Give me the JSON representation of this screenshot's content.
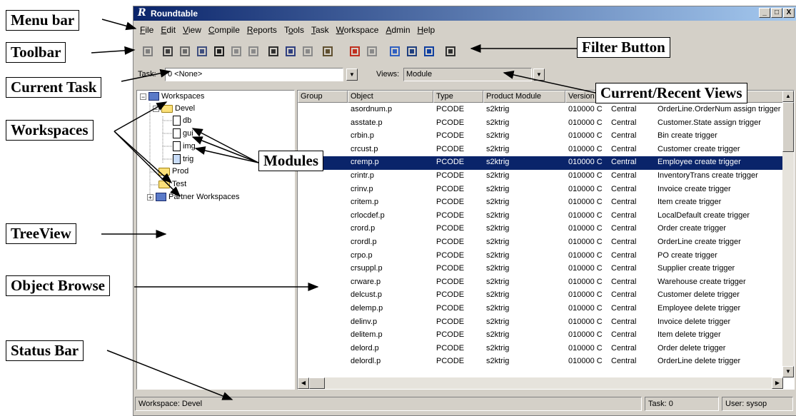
{
  "window": {
    "app_icon": "R",
    "title": "Roundtable",
    "controls": [
      "_",
      "□",
      "X"
    ]
  },
  "menu": [
    {
      "pre": "",
      "ul": "F",
      "post": "ile"
    },
    {
      "pre": "",
      "ul": "E",
      "post": "dit"
    },
    {
      "pre": "",
      "ul": "V",
      "post": "iew"
    },
    {
      "pre": "",
      "ul": "C",
      "post": "ompile"
    },
    {
      "pre": "",
      "ul": "R",
      "post": "eports"
    },
    {
      "pre": "T",
      "ul": "o",
      "post": "ols"
    },
    {
      "pre": "",
      "ul": "T",
      "post": "ask"
    },
    {
      "pre": "",
      "ul": "W",
      "post": "orkspace"
    },
    {
      "pre": "",
      "ul": "A",
      "post": "dmin"
    },
    {
      "pre": "",
      "ul": "H",
      "post": "elp"
    }
  ],
  "toolbar_icons": [
    "checkout-icon",
    "checkin-icon",
    "edit-icon",
    "search-icon",
    "find-icon",
    "new-icon",
    "open-icon",
    "properties-icon",
    "compare-icon",
    "assign-icon",
    "report-icon",
    "palette-icon",
    "clipboard-icon",
    "move-left-icon",
    "move-right-icon",
    "copy-icon",
    "filter-icon"
  ],
  "task_bar": {
    "task_label": "Task:",
    "task_value": "0 <None>",
    "views_label": "Views:",
    "views_value": "Module"
  },
  "tree": {
    "root": "Workspaces",
    "devel": "Devel",
    "modules": [
      "db",
      "gui",
      "img",
      "trig"
    ],
    "prod": "Prod",
    "test": "Test",
    "partner": "Partner Workspaces"
  },
  "browse": {
    "columns": [
      "Group",
      "Object",
      "Type",
      "Product Module",
      "Version",
      "",
      ""
    ],
    "rows": [
      [
        "",
        "asordnum.p",
        "PCODE",
        "s2ktrig",
        "010000 C",
        "Central",
        "OrderLine.OrderNum assign trigger"
      ],
      [
        "",
        "asstate.p",
        "PCODE",
        "s2ktrig",
        "010000 C",
        "Central",
        "Customer.State assign trigger"
      ],
      [
        "",
        "crbin.p",
        "PCODE",
        "s2ktrig",
        "010000 C",
        "Central",
        "Bin create trigger"
      ],
      [
        "",
        "crcust.p",
        "PCODE",
        "s2ktrig",
        "010000 C",
        "Central",
        "Customer create trigger"
      ],
      [
        "",
        "cremp.p",
        "PCODE",
        "s2ktrig",
        "010000 C",
        "Central",
        "Employee create trigger"
      ],
      [
        "",
        "crintr.p",
        "PCODE",
        "s2ktrig",
        "010000 C",
        "Central",
        "InventoryTrans create trigger"
      ],
      [
        "",
        "crinv.p",
        "PCODE",
        "s2ktrig",
        "010000 C",
        "Central",
        "Invoice create trigger"
      ],
      [
        "",
        "critem.p",
        "PCODE",
        "s2ktrig",
        "010000 C",
        "Central",
        "Item create trigger"
      ],
      [
        "",
        "crlocdef.p",
        "PCODE",
        "s2ktrig",
        "010000 C",
        "Central",
        "LocalDefault create trigger"
      ],
      [
        "",
        "crord.p",
        "PCODE",
        "s2ktrig",
        "010000 C",
        "Central",
        "Order create trigger"
      ],
      [
        "",
        "crordl.p",
        "PCODE",
        "s2ktrig",
        "010000 C",
        "Central",
        "OrderLine create trigger"
      ],
      [
        "",
        "crpo.p",
        "PCODE",
        "s2ktrig",
        "010000 C",
        "Central",
        "PO create trigger"
      ],
      [
        "",
        "crsuppl.p",
        "PCODE",
        "s2ktrig",
        "010000 C",
        "Central",
        "Supplier create trigger"
      ],
      [
        "",
        "crware.p",
        "PCODE",
        "s2ktrig",
        "010000 C",
        "Central",
        "Warehouse create trigger"
      ],
      [
        "",
        "delcust.p",
        "PCODE",
        "s2ktrig",
        "010000 C",
        "Central",
        "Customer delete trigger"
      ],
      [
        "",
        "delemp.p",
        "PCODE",
        "s2ktrig",
        "010000 C",
        "Central",
        "Employee delete trigger"
      ],
      [
        "",
        "delinv.p",
        "PCODE",
        "s2ktrig",
        "010000 C",
        "Central",
        "Invoice delete trigger"
      ],
      [
        "",
        "delitem.p",
        "PCODE",
        "s2ktrig",
        "010000 C",
        "Central",
        "Item delete trigger"
      ],
      [
        "",
        "delord.p",
        "PCODE",
        "s2ktrig",
        "010000 C",
        "Central",
        "Order delete trigger"
      ],
      [
        "",
        "delordl.p",
        "PCODE",
        "s2ktrig",
        "010000 C",
        "Central",
        "OrderLine delete trigger"
      ]
    ],
    "selected_row": 4
  },
  "status": {
    "workspace": "Workspace: Devel",
    "task": "Task: 0",
    "user": "User: sysop"
  },
  "callouts": {
    "menu_bar": "Menu bar",
    "toolbar": "Toolbar",
    "current_task": "Current Task",
    "workspaces": "Workspaces",
    "treeview": "TreeView",
    "object_browse": "Object Browse",
    "status_bar": "Status Bar",
    "filter_button": "Filter Button",
    "current_views": "Current/Recent Views",
    "modules": "Modules"
  }
}
